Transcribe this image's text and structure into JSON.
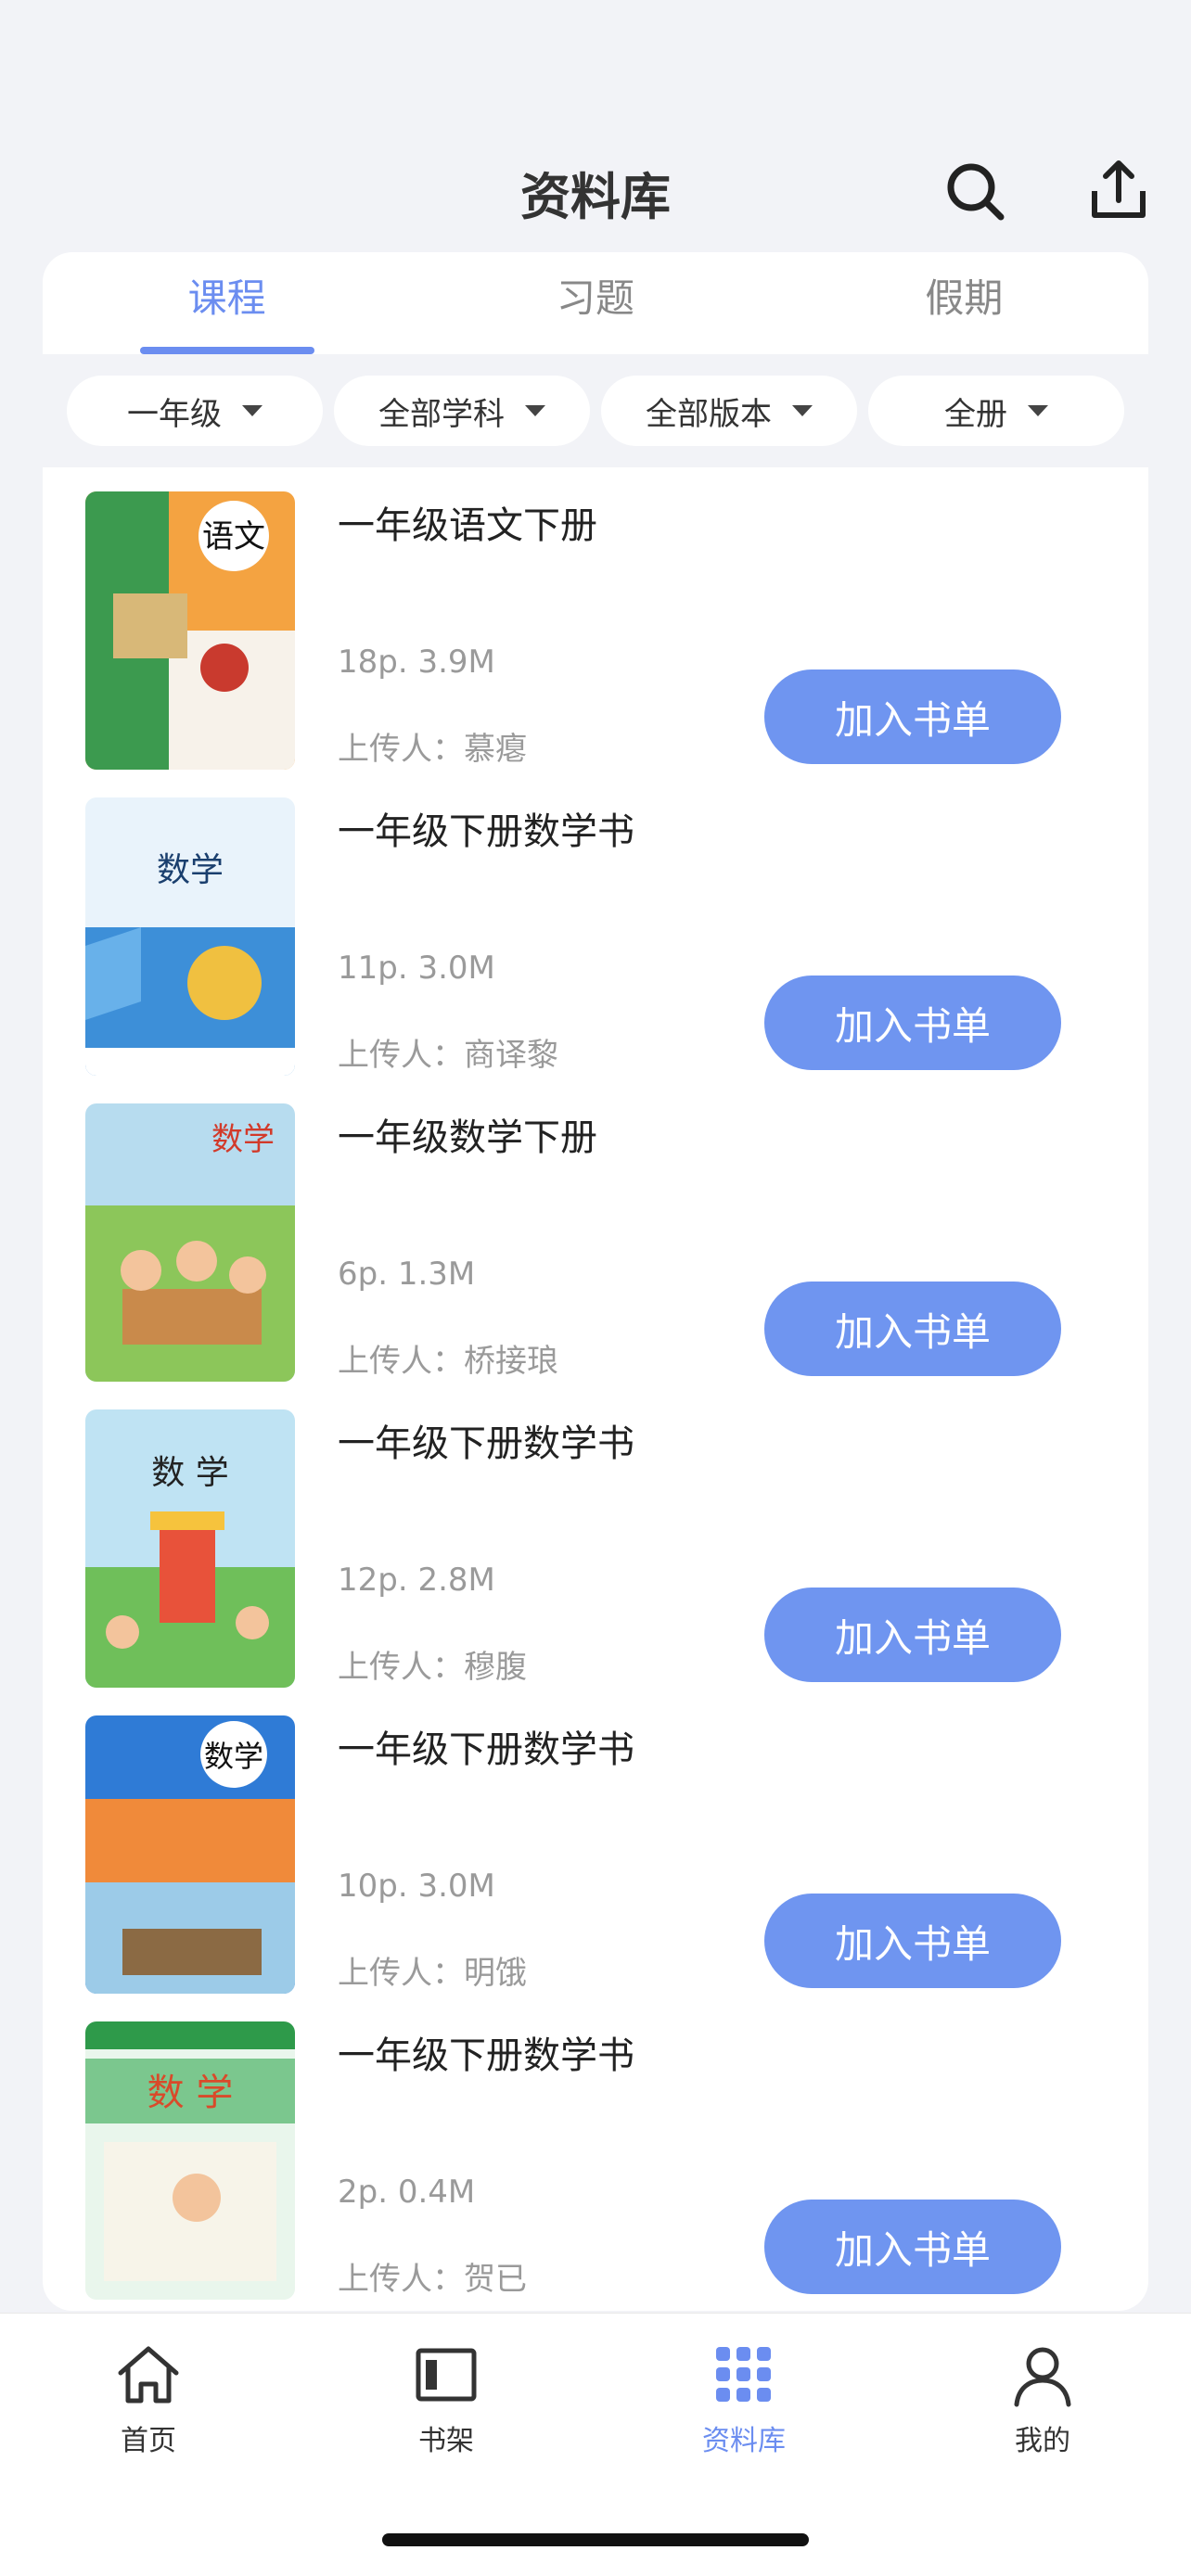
{
  "header": {
    "title": "资料库"
  },
  "tabs": [
    {
      "label": "课程",
      "active": true
    },
    {
      "label": "习题",
      "active": false
    },
    {
      "label": "假期",
      "active": false
    }
  ],
  "filters": [
    {
      "label": "一年级"
    },
    {
      "label": "全部学科"
    },
    {
      "label": "全部版本"
    },
    {
      "label": "全册"
    }
  ],
  "items": [
    {
      "title": "一年级语文下册",
      "meta": "18p. 3.9M",
      "uploader": "上传人：慕瘪",
      "button": "加入书单",
      "cover_text": "语文"
    },
    {
      "title": "一年级下册数学书",
      "meta": "11p. 3.0M",
      "uploader": "上传人：商译黎",
      "button": "加入书单",
      "cover_text": "数学"
    },
    {
      "title": "一年级数学下册",
      "meta": "6p. 1.3M",
      "uploader": "上传人：桥接琅",
      "button": "加入书单",
      "cover_text": "数学"
    },
    {
      "title": "一年级下册数学书",
      "meta": "12p. 2.8M",
      "uploader": "上传人：穆腹",
      "button": "加入书单",
      "cover_text": "数 学"
    },
    {
      "title": "一年级下册数学书",
      "meta": "10p. 3.0M",
      "uploader": "上传人：明饿",
      "button": "加入书单",
      "cover_text": "数学"
    },
    {
      "title": "一年级下册数学书",
      "meta": "2p. 0.4M",
      "uploader": "上传人：贺已",
      "button": "加入书单",
      "cover_text": "数 学"
    }
  ],
  "nav": [
    {
      "label": "首页",
      "icon": "home-icon"
    },
    {
      "label": "书架",
      "icon": "bookshelf-icon"
    },
    {
      "label": "资料库",
      "icon": "grid-icon",
      "active": true
    },
    {
      "label": "我的",
      "icon": "user-icon"
    }
  ],
  "colors": {
    "accent": "#6b8df0",
    "button": "#6f95f0",
    "background": "#f2f3f7"
  }
}
